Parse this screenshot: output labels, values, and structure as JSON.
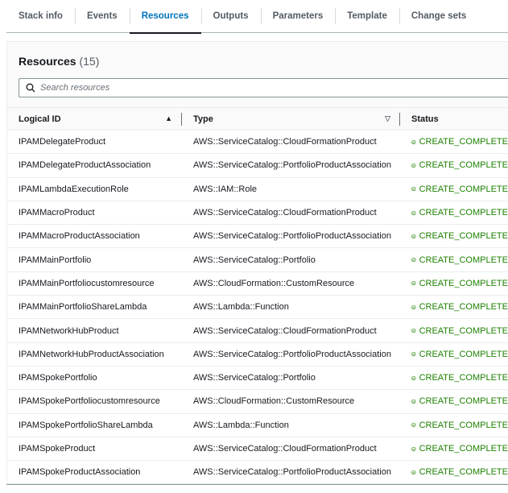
{
  "tabs": [
    {
      "label": "Stack info"
    },
    {
      "label": "Events"
    },
    {
      "label": "Resources"
    },
    {
      "label": "Outputs"
    },
    {
      "label": "Parameters"
    },
    {
      "label": "Template"
    },
    {
      "label": "Change sets"
    }
  ],
  "panel": {
    "title": "Resources",
    "count": "(15)",
    "search_placeholder": "Search resources"
  },
  "columns": {
    "logical_id": "Logical ID",
    "type": "Type",
    "status": "Status"
  },
  "rows": [
    {
      "id": "IPAMDelegateProduct",
      "type": "AWS::ServiceCatalog::CloudFormationProduct",
      "status": "CREATE_COMPLETE"
    },
    {
      "id": "IPAMDelegateProductAssociation",
      "type": "AWS::ServiceCatalog::PortfolioProductAssociation",
      "status": "CREATE_COMPLETE"
    },
    {
      "id": "IPAMLambdaExecutionRole",
      "type": "AWS::IAM::Role",
      "status": "CREATE_COMPLETE"
    },
    {
      "id": "IPAMMacroProduct",
      "type": "AWS::ServiceCatalog::CloudFormationProduct",
      "status": "CREATE_COMPLETE"
    },
    {
      "id": "IPAMMacroProductAssociation",
      "type": "AWS::ServiceCatalog::PortfolioProductAssociation",
      "status": "CREATE_COMPLETE"
    },
    {
      "id": "IPAMMainPortfolio",
      "type": "AWS::ServiceCatalog::Portfolio",
      "status": "CREATE_COMPLETE"
    },
    {
      "id": "IPAMMainPortfoliocustomresource",
      "type": "AWS::CloudFormation::CustomResource",
      "status": "CREATE_COMPLETE"
    },
    {
      "id": "IPAMMainPortfolioShareLambda",
      "type": "AWS::Lambda::Function",
      "status": "CREATE_COMPLETE"
    },
    {
      "id": "IPAMNetworkHubProduct",
      "type": "AWS::ServiceCatalog::CloudFormationProduct",
      "status": "CREATE_COMPLETE"
    },
    {
      "id": "IPAMNetworkHubProductAssociation",
      "type": "AWS::ServiceCatalog::PortfolioProductAssociation",
      "status": "CREATE_COMPLETE"
    },
    {
      "id": "IPAMSpokePortfolio",
      "type": "AWS::ServiceCatalog::Portfolio",
      "status": "CREATE_COMPLETE"
    },
    {
      "id": "IPAMSpokePortfoliocustomresource",
      "type": "AWS::CloudFormation::CustomResource",
      "status": "CREATE_COMPLETE"
    },
    {
      "id": "IPAMSpokePortfolioShareLambda",
      "type": "AWS::Lambda::Function",
      "status": "CREATE_COMPLETE"
    },
    {
      "id": "IPAMSpokeProduct",
      "type": "AWS::ServiceCatalog::CloudFormationProduct",
      "status": "CREATE_COMPLETE"
    },
    {
      "id": "IPAMSpokeProductAssociation",
      "type": "AWS::ServiceCatalog::PortfolioProductAssociation",
      "status": "CREATE_COMPLETE"
    }
  ],
  "colors": {
    "active_tab": "#0073bb",
    "success": "#1d8102"
  }
}
